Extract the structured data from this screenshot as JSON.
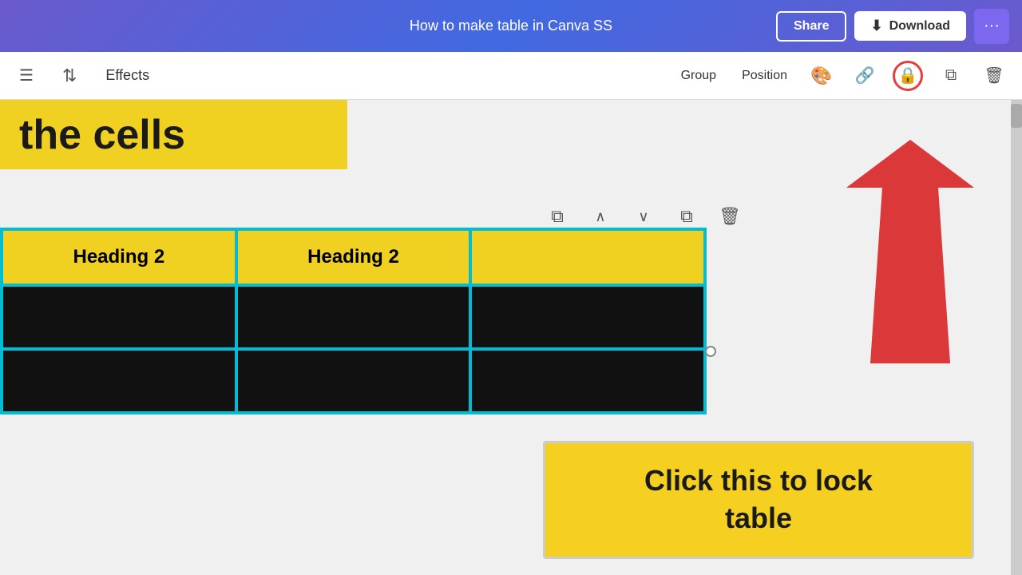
{
  "topbar": {
    "title": "How to make table in Canva SS",
    "share_label": "Share",
    "download_label": "Download",
    "more_label": "···"
  },
  "toolbar": {
    "menu_icon": "☰",
    "sort_icon": "⇅",
    "effects_label": "Effects",
    "group_label": "Group",
    "position_label": "Position",
    "paint_icon": "🎨",
    "link_icon": "🔗",
    "lock_icon": "🔒",
    "copy_icon": "⧉",
    "delete_icon": "🗑"
  },
  "canvas": {
    "header_text": "the cells",
    "table": {
      "rows": [
        [
          "Heading 2",
          "Heading 2",
          ""
        ],
        [
          "",
          "",
          ""
        ],
        [
          "",
          "",
          ""
        ]
      ]
    },
    "table_toolbar": {
      "copy_icon": "⧉",
      "up_icon": "∧",
      "down_icon": "∨",
      "duplicate_icon": "⧉",
      "delete_icon": "🗑"
    }
  },
  "tooltip": {
    "text": "Click this to lock\ntable"
  }
}
